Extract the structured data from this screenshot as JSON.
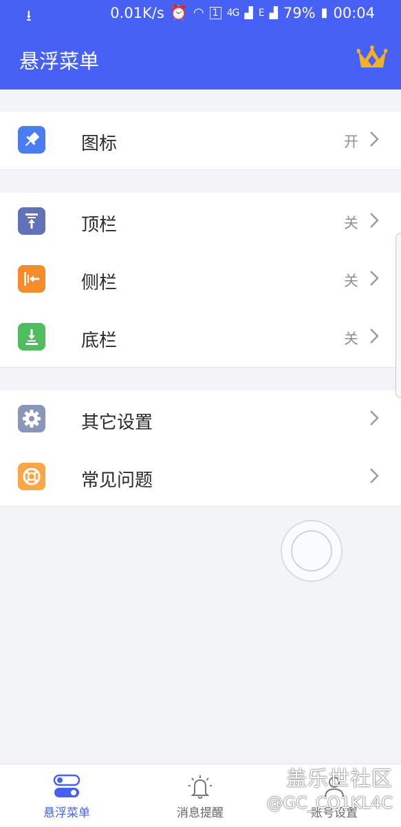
{
  "status_bar": {
    "speed": "0.01K/s",
    "network_4g": "4G",
    "network_e": "E",
    "battery": "79%",
    "time": "00:04"
  },
  "app_bar": {
    "title": "悬浮菜单",
    "crown_color": "#f5b120"
  },
  "groups": [
    {
      "items": [
        {
          "label": "图标",
          "value": "开",
          "icon": "pin-icon",
          "color": "#4a7cf2"
        }
      ]
    },
    {
      "items": [
        {
          "label": "顶栏",
          "value": "关",
          "icon": "top-bar-icon",
          "color": "#6172b8"
        },
        {
          "label": "侧栏",
          "value": "关",
          "icon": "side-bar-icon",
          "color": "#f58b2a"
        },
        {
          "label": "底栏",
          "value": "关",
          "icon": "bottom-bar-icon",
          "color": "#4fbd5d"
        }
      ]
    },
    {
      "items": [
        {
          "label": "其它设置",
          "value": "",
          "icon": "gear-icon",
          "color": "#8a96b8"
        },
        {
          "label": "常见问题",
          "value": "",
          "icon": "lifebuoy-icon",
          "color": "#f9a648"
        }
      ]
    }
  ],
  "tab_bar": {
    "tabs": [
      {
        "label": "悬浮菜单",
        "icon": "toggle-icon",
        "active": true
      },
      {
        "label": "消息提醒",
        "icon": "bell-icon",
        "active": false
      },
      {
        "label": "账号设置",
        "icon": "account-icon",
        "active": false
      }
    ]
  },
  "watermark": {
    "line1": "盖乐世社区",
    "line2": "@GC_CO1KL4C"
  },
  "accent_color": "#4760f5"
}
